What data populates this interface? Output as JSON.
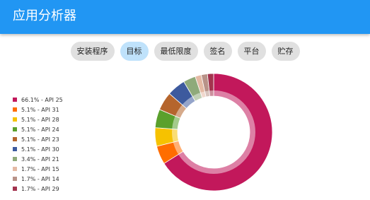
{
  "app": {
    "title": "应用分析器"
  },
  "tabs": [
    {
      "label": "安装程序",
      "active": false
    },
    {
      "label": "目标",
      "active": true
    },
    {
      "label": "最低限度",
      "active": false
    },
    {
      "label": "签名",
      "active": false
    },
    {
      "label": "平台",
      "active": false
    },
    {
      "label": "贮存",
      "active": false
    }
  ],
  "chart_data": {
    "type": "pie",
    "donut": true,
    "legend_position": "left",
    "slices": [
      {
        "label": "66.1% - API 25",
        "value": 66.1,
        "color": "#c2185b"
      },
      {
        "label": "5.1% - API 31",
        "value": 5.1,
        "color": "#ff6d00"
      },
      {
        "label": "5.1% - API 28",
        "value": 5.1,
        "color": "#f6c200"
      },
      {
        "label": "5.1% - API 24",
        "value": 5.1,
        "color": "#5aa02c"
      },
      {
        "label": "5.1% - API 23",
        "value": 5.1,
        "color": "#b5652d"
      },
      {
        "label": "5.1% - API 30",
        "value": 5.1,
        "color": "#3d5a9e"
      },
      {
        "label": "3.4% - API 21",
        "value": 3.4,
        "color": "#8faa7a"
      },
      {
        "label": "1.7% - API 15",
        "value": 1.7,
        "color": "#e4b9a4"
      },
      {
        "label": "1.7% - API 14",
        "value": 1.7,
        "color": "#b89288"
      },
      {
        "label": "1.7% - API 29",
        "value": 1.7,
        "color": "#a3334e"
      }
    ]
  }
}
